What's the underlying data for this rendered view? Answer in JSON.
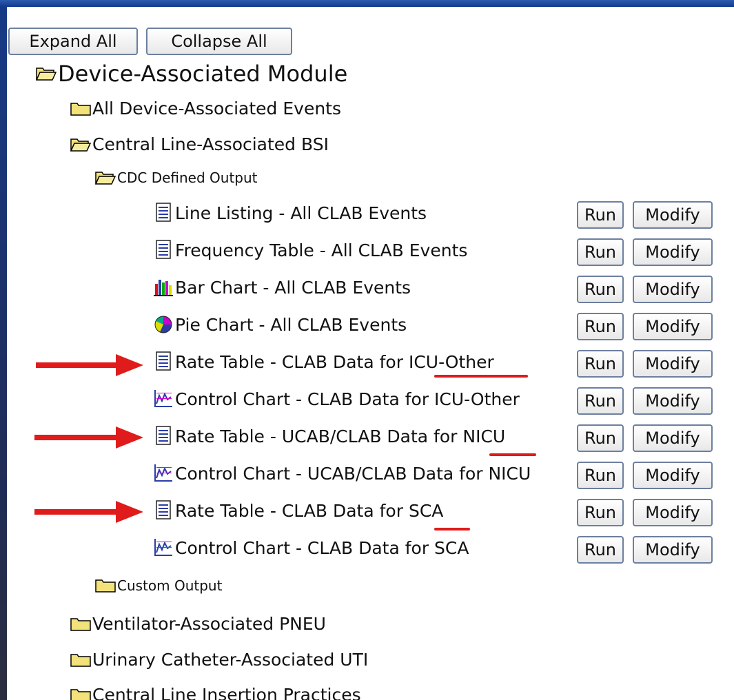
{
  "toolbar": {
    "expand_label": "Expand All",
    "collapse_label": "Collapse All"
  },
  "tree": {
    "module": "Device-Associated Module",
    "all_events": "All Device-Associated Events",
    "clabsi": "Central Line-Associated BSI",
    "cdc_output": "CDC Defined Output",
    "custom_output": "Custom Output",
    "vap": "Ventilator-Associated PNEU",
    "uti": "Urinary Catheter-Associated UTI",
    "clip": "Central Line Insertion Practices"
  },
  "reports": [
    {
      "label": "Line Listing - All CLAB Events",
      "icon": "document-icon"
    },
    {
      "label": "Frequency Table - All CLAB Events",
      "icon": "document-icon"
    },
    {
      "label": "Bar Chart - All CLAB Events",
      "icon": "bar-chart-icon"
    },
    {
      "label": "Pie Chart - All CLAB Events",
      "icon": "pie-chart-icon"
    },
    {
      "label": "Rate Table - CLAB Data for ICU-Other",
      "icon": "document-icon"
    },
    {
      "label": "Control Chart - CLAB Data for ICU-Other",
      "icon": "control-chart-icon"
    },
    {
      "label": "Rate Table - UCAB/CLAB Data for NICU",
      "icon": "document-icon"
    },
    {
      "label": "Control Chart - UCAB/CLAB Data for NICU",
      "icon": "control-chart-icon"
    },
    {
      "label": "Rate Table - CLAB Data for SCA",
      "icon": "document-icon"
    },
    {
      "label": "Control Chart - CLAB Data for SCA",
      "icon": "control-chart-icon"
    }
  ],
  "row_buttons": {
    "run_label": "Run",
    "modify_label": "Modify"
  },
  "colors": {
    "background": "#1b3a78",
    "annotation": "#e01b1b",
    "folder": "#f3e27a"
  }
}
